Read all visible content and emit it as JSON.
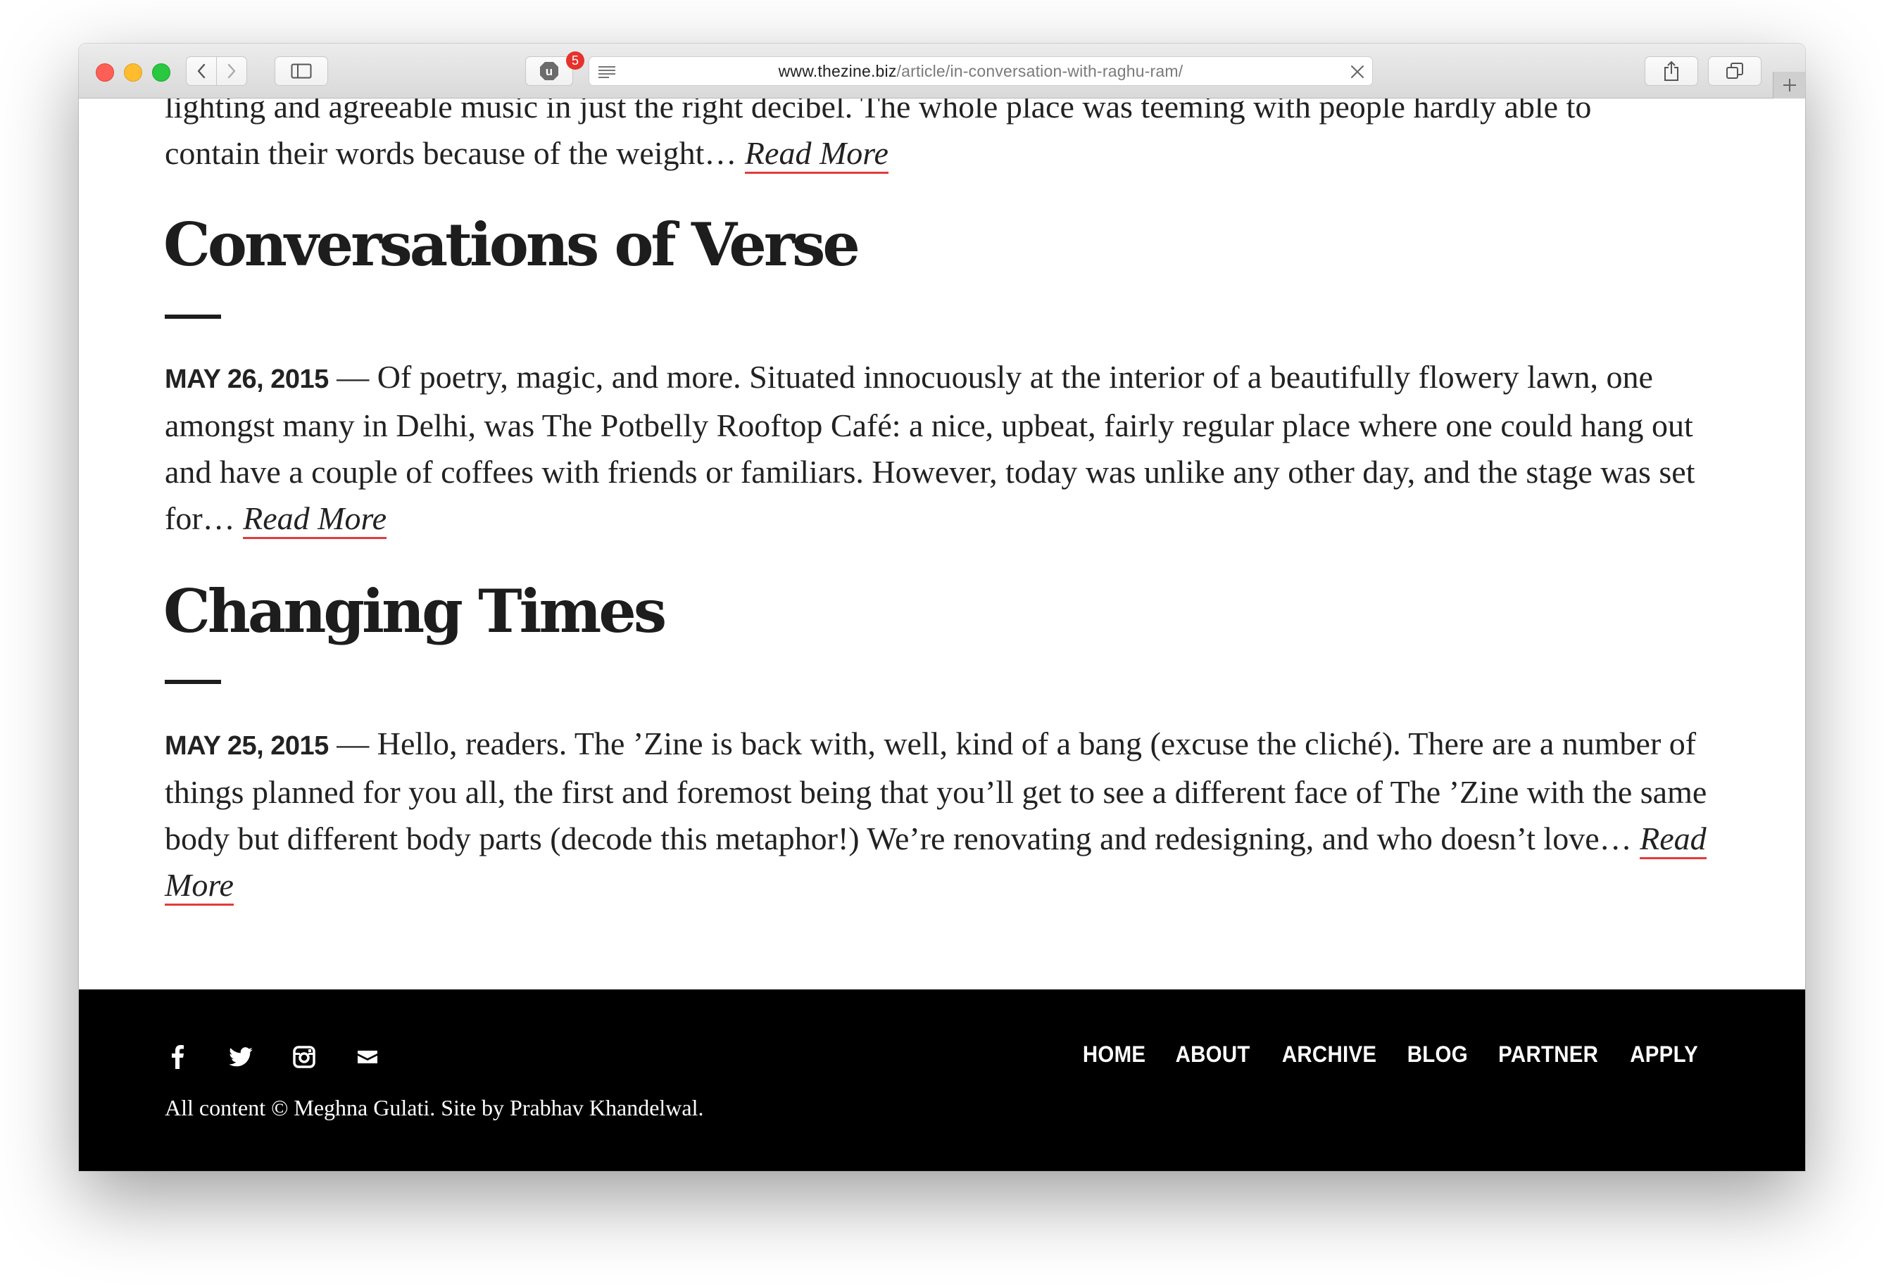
{
  "browser": {
    "url_host": "www.thezine.biz",
    "url_path": "/article/in-conversation-with-raghu-ram/",
    "extension_badge": "5",
    "extension_letter": "u"
  },
  "articles": {
    "partial": {
      "excerpt_top": "lighting and agreeable music in just the right decibel. The whole place was teeming with people hardly able to",
      "excerpt_bottom": "contain their words because of the weight…",
      "read_more": "Read More"
    },
    "items": [
      {
        "title": "Conversations of Verse",
        "date": "MAY 26, 2015",
        "separator": " — ",
        "excerpt": "Of poetry, magic, and more. Situated innocuously at the interior of a beautifully flowery lawn, one amongst many in Delhi, was The Potbelly Rooftop Café: a nice, upbeat, fairly regular place where one could hang out and have a couple of coffees with friends or familiars. However, today was unlike any other day, and the stage was set for…",
        "read_more": "Read More"
      },
      {
        "title": "Changing Times",
        "date": "MAY 25, 2015",
        "separator": " — ",
        "excerpt": "Hello, readers. The ’Zine is back with, well, kind of a bang (excuse the cliché). There are a number of things planned for you all, the first and foremost being that you’ll get to see a different face of The ’Zine with the same body but different body parts (decode this metaphor!) We’re renovating and redesigning, and who doesn’t love…",
        "read_more": "Read More"
      }
    ]
  },
  "footer": {
    "social_icons": [
      "facebook-icon",
      "twitter-icon",
      "instagram-icon",
      "mail-icon"
    ],
    "nav": [
      "HOME",
      "ABOUT",
      "ARCHIVE",
      "BLOG",
      "PARTNER",
      "APPLY"
    ],
    "copyright": "All content © Meghna Gulati. Site by Prabhav Khandelwal."
  },
  "colors": {
    "accent_underline": "#e23b3b",
    "footer_bg": "#000000",
    "text": "#222222"
  }
}
